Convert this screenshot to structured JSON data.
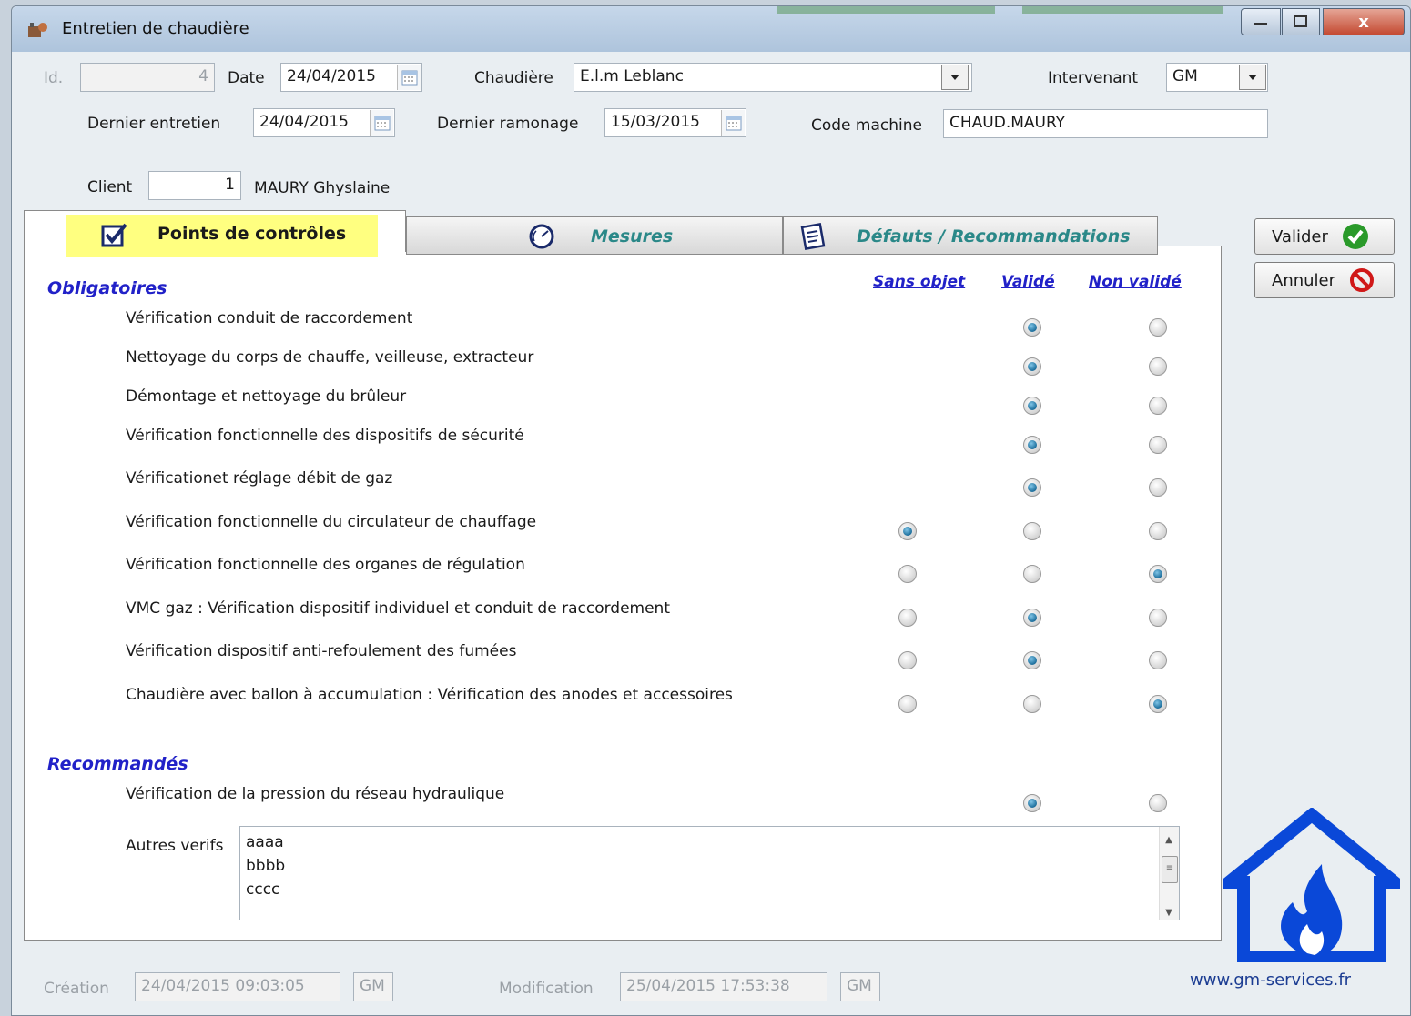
{
  "window": {
    "title": "Entretien de chaudière",
    "close_glyph": "x",
    "app_icon": "boiler-app-icon"
  },
  "header": {
    "id_label": "Id.",
    "id_value": "4",
    "date_label": "Date",
    "date_value": "24/04/2015",
    "chaudiere_label": "Chaudière",
    "chaudiere_value": "E.l.m Leblanc",
    "intervenant_label": "Intervenant",
    "intervenant_value": "GM",
    "dernier_entretien_label": "Dernier entretien",
    "dernier_entretien_value": "24/04/2015",
    "dernier_ramonage_label": "Dernier ramonage",
    "dernier_ramonage_value": "15/03/2015",
    "code_machine_label": "Code machine",
    "code_machine_value": "CHAUD.MAURY",
    "client_label": "Client",
    "client_id": "1",
    "client_name": "MAURY Ghyslaine"
  },
  "tabs": [
    {
      "label": "Points de contrôles",
      "icon": "checkbox-icon",
      "active": true
    },
    {
      "label": "Mesures",
      "icon": "gauge-icon",
      "active": false
    },
    {
      "label": "Défauts / Recommandations",
      "icon": "notepad-icon",
      "active": false
    }
  ],
  "columns": {
    "sans_objet": "Sans objet",
    "valide": "Validé",
    "non_valide": "Non validé"
  },
  "obligatoires": {
    "title": "Obligatoires",
    "rows": [
      {
        "label": "Vérification conduit de raccordement",
        "has_sans_objet": false,
        "selected": "valide"
      },
      {
        "label": "Nettoyage du corps de chauffe, veilleuse, extracteur",
        "has_sans_objet": false,
        "selected": "valide"
      },
      {
        "label": "Démontage et nettoyage du brûleur",
        "has_sans_objet": false,
        "selected": "valide"
      },
      {
        "label": "Vérification fonctionnelle des dispositifs de sécurité",
        "has_sans_objet": false,
        "selected": "valide"
      },
      {
        "label": "Vérificationet réglage débit de gaz",
        "has_sans_objet": false,
        "selected": "valide"
      },
      {
        "label": "Vérification fonctionnelle du circulateur de chauffage",
        "has_sans_objet": true,
        "selected": "sans_objet"
      },
      {
        "label": "Vérification fonctionnelle des organes de régulation",
        "has_sans_objet": true,
        "selected": "non_valide"
      },
      {
        "label": "VMC gaz : Vérification dispositif individuel et conduit de raccordement",
        "has_sans_objet": true,
        "selected": "valide"
      },
      {
        "label": "Vérification dispositif anti-refoulement des fumées",
        "has_sans_objet": true,
        "selected": "valide"
      },
      {
        "label": "Chaudière avec ballon à accumulation : Vérification des anodes et accessoires",
        "has_sans_objet": true,
        "selected": "non_valide"
      }
    ]
  },
  "recommandes": {
    "title": "Recommandés",
    "rows": [
      {
        "label": "Vérification de la pression du réseau hydraulique",
        "has_sans_objet": false,
        "selected": "valide"
      }
    ],
    "autres_label": "Autres verifs",
    "autres_lines": [
      "aaaa",
      "bbbb",
      "cccc"
    ]
  },
  "actions": {
    "valider": "Valider",
    "annuler": "Annuler"
  },
  "footer": {
    "creation_label": "Création",
    "creation_value": "24/04/2015 09:03:05",
    "creation_user": "GM",
    "modification_label": "Modification",
    "modification_value": "25/04/2015 17:53:38",
    "modification_user": "GM",
    "website": "www.gm-services.fr"
  },
  "colors": {
    "section_blue": "#2121c8",
    "tab_teal": "#2a8888",
    "active_tab_highlight": "#ffff80",
    "logo_blue": "#0a48d8"
  }
}
